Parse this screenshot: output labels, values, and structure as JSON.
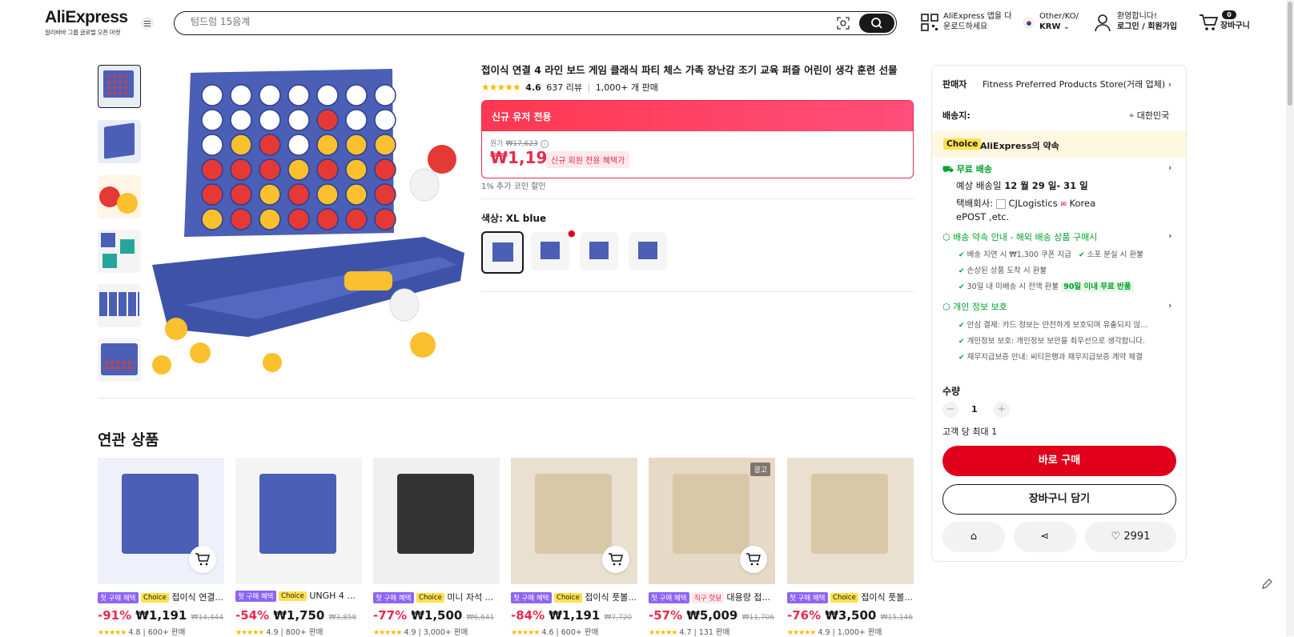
{
  "header": {
    "logo": "AliExpress",
    "logo_sub": "알리바바 그룹 글로벌 오픈 마켓",
    "search_placeholder": "텀드럼 15음계",
    "app_line1": "AliExpress 앱을 다",
    "app_line2": "운로드하세요",
    "lang_line1": "Other/KO/",
    "lang_line2": "KRW",
    "user_line1": "환영합니다!",
    "user_line2": "로그인 / 회원가입",
    "cart_count": "0",
    "cart_label": "장바구니"
  },
  "product": {
    "title": "접이식 연결 4 라인 보드 게임 클래식 파티 체스 가족 장난감 조기 교육 퍼즐 어린이 생각 훈련 선물",
    "rating": "4.6",
    "reviews": "637 리뷰",
    "sold": "1,000+ 개 판매",
    "promo_header": "신규 유저 전용",
    "original_label": "원가",
    "original_price": "₩17,623",
    "price": "₩1,191",
    "price_tag": "신규 회원 전용 혜택가",
    "coin_note": "1% 추가 코인 할인",
    "color_label": "색상:",
    "color_value": "XL blue"
  },
  "related": {
    "title": "연관 상품",
    "items": [
      {
        "badge1": "첫 구매 혜택",
        "badge2": "Choice",
        "name": "접이식 연결...",
        "discount": "-91%",
        "price": "₩1,191",
        "orig": "₩14,444",
        "rating": "4.8",
        "sold": "600+ 판매"
      },
      {
        "badge1": "첫 구매 혜택",
        "badge2": "Choice",
        "name": "UNGH 4 ...",
        "discount": "-54%",
        "price": "₩1,750",
        "orig": "₩3,858",
        "rating": "4.9",
        "sold": "800+ 판매"
      },
      {
        "badge1": "첫 구매 혜택",
        "badge2": "Choice",
        "name": "미니 자석 ...",
        "discount": "-77%",
        "price": "₩1,500",
        "orig": "₩6,641",
        "rating": "4.9",
        "sold": "3,000+ 판매"
      },
      {
        "badge1": "첫 구매 혜택",
        "badge2": "Choice",
        "name": "접이식 풋볼...",
        "discount": "-84%",
        "price": "₩1,191",
        "orig": "₩7,720",
        "rating": "4.6",
        "sold": "600+ 판매"
      },
      {
        "badge1": "첫 구매 혜택",
        "badge2": "직구 핫딜",
        "name": "대용량 접...",
        "discount": "-57%",
        "price": "₩5,009",
        "orig": "₩11,706",
        "rating": "4.7",
        "sold": "131 판매",
        "ad": "광고"
      },
      {
        "badge1": "첫 구매 혜택",
        "badge2": "Choice",
        "name": "접이식 풋볼...",
        "discount": "-76%",
        "price": "₩3,500",
        "orig": "₩15,146",
        "rating": "4.9",
        "sold": "1,000+ 판매"
      }
    ]
  },
  "panel": {
    "seller_label": "판매자",
    "seller_name": "Fitness Preferred Products Store(거래 업체)",
    "ship_label": "배송지:",
    "ship_country": "대한민국",
    "choice_tag": "Choice",
    "choice_text": "AliExpress의 약속",
    "free_ship": "무료 배송",
    "eta_prefix": "예상 배송일",
    "eta_dates": "12 월 29 일- 31 일",
    "carrier_prefix": "택배회사:",
    "carrier1": "CJLogistics",
    "carrier2": "Korea",
    "carrier3": "ePOST ,etc.",
    "promise_title": "배송 약속 안내 - 해외 배송 상품 구매시",
    "promise1": "배송 지연 시 ₩1,300 쿠폰 지급",
    "promise2": "소포 분실 시 환불",
    "promise3": "손상된 상품 도착 시 환불",
    "promise4": "30일 내 미배송 시 전액 환불",
    "promise4_tag": "90일 이내 무료 반품",
    "privacy_title": "개인 정보 보호",
    "privacy1": "안심 결제: 카드 정보는 안전하게 보호되며 유출되지 않...",
    "privacy2": "개인정보 보호: 개인정보 보안을 최우선으로 생각합니다.",
    "privacy3": "채무지급보증 안내: 씨티은행과 채무지급보증 계약 체결",
    "qty_label": "수량",
    "qty_value": "1",
    "qty_limit": "고객 당 최대 1",
    "buy_now": "바로 구매",
    "add_cart": "장바구니 담기",
    "wish_count": "2991"
  },
  "colors": {
    "accent": "#e0001c",
    "promo": "#fd384f",
    "choice": "#ffe14d",
    "green": "#00a12b",
    "game_blue": "#4a5fb5"
  }
}
